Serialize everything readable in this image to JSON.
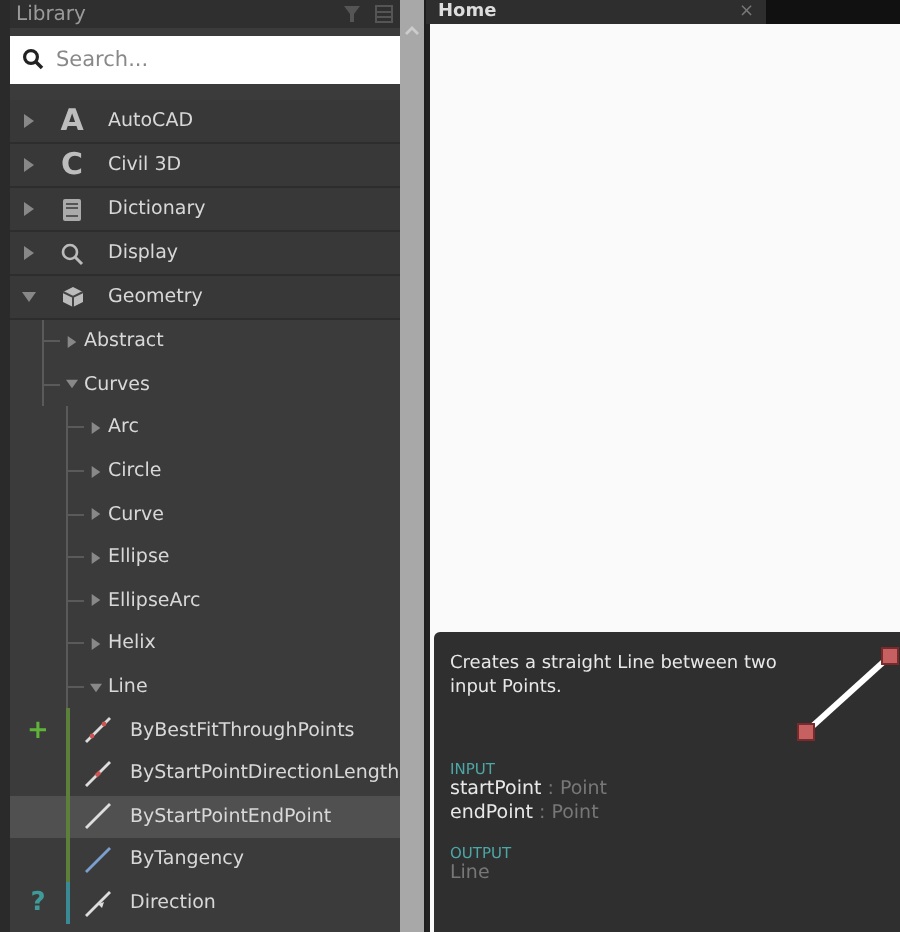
{
  "library": {
    "title": "Library",
    "search": {
      "placeholder": "Search..."
    },
    "tree": [
      {
        "label": "AutoCAD",
        "glyph": "A",
        "expanded": false
      },
      {
        "label": "Civil 3D",
        "glyph": "C",
        "expanded": false
      },
      {
        "label": "Dictionary",
        "expanded": false
      },
      {
        "label": "Display",
        "expanded": false
      },
      {
        "label": "Geometry",
        "expanded": true,
        "children": [
          {
            "label": "Abstract",
            "expanded": false
          },
          {
            "label": "Curves",
            "expanded": true,
            "children": [
              {
                "label": "Arc",
                "expanded": false
              },
              {
                "label": "Circle",
                "expanded": false
              },
              {
                "label": "Curve",
                "expanded": false
              },
              {
                "label": "Ellipse",
                "expanded": false
              },
              {
                "label": "EllipseArc",
                "expanded": false
              },
              {
                "label": "Helix",
                "expanded": false
              },
              {
                "label": "Line",
                "expanded": true,
                "children": [
                  {
                    "label": "ByBestFitThroughPoints",
                    "kind": "create",
                    "marker": "+",
                    "selected": false
                  },
                  {
                    "label": "ByStartPointDirectionLength",
                    "kind": "create",
                    "selected": false
                  },
                  {
                    "label": "ByStartPointEndPoint",
                    "kind": "create",
                    "selected": true
                  },
                  {
                    "label": "ByTangency",
                    "kind": "create",
                    "selected": false
                  },
                  {
                    "label": "Direction",
                    "kind": "query",
                    "marker": "?",
                    "selected": false
                  }
                ]
              }
            ]
          }
        ]
      }
    ]
  },
  "tabs": [
    {
      "label": "Home",
      "close": "×",
      "selected": true
    }
  ],
  "tooltip": {
    "description": "Creates a straight Line between two input Points.",
    "input_heading": "INPUT",
    "inputs": [
      {
        "name": "startPoint",
        "type": ": Point"
      },
      {
        "name": "endPoint",
        "type": ": Point"
      }
    ],
    "output_heading": "OUTPUT",
    "output": "Line"
  }
}
